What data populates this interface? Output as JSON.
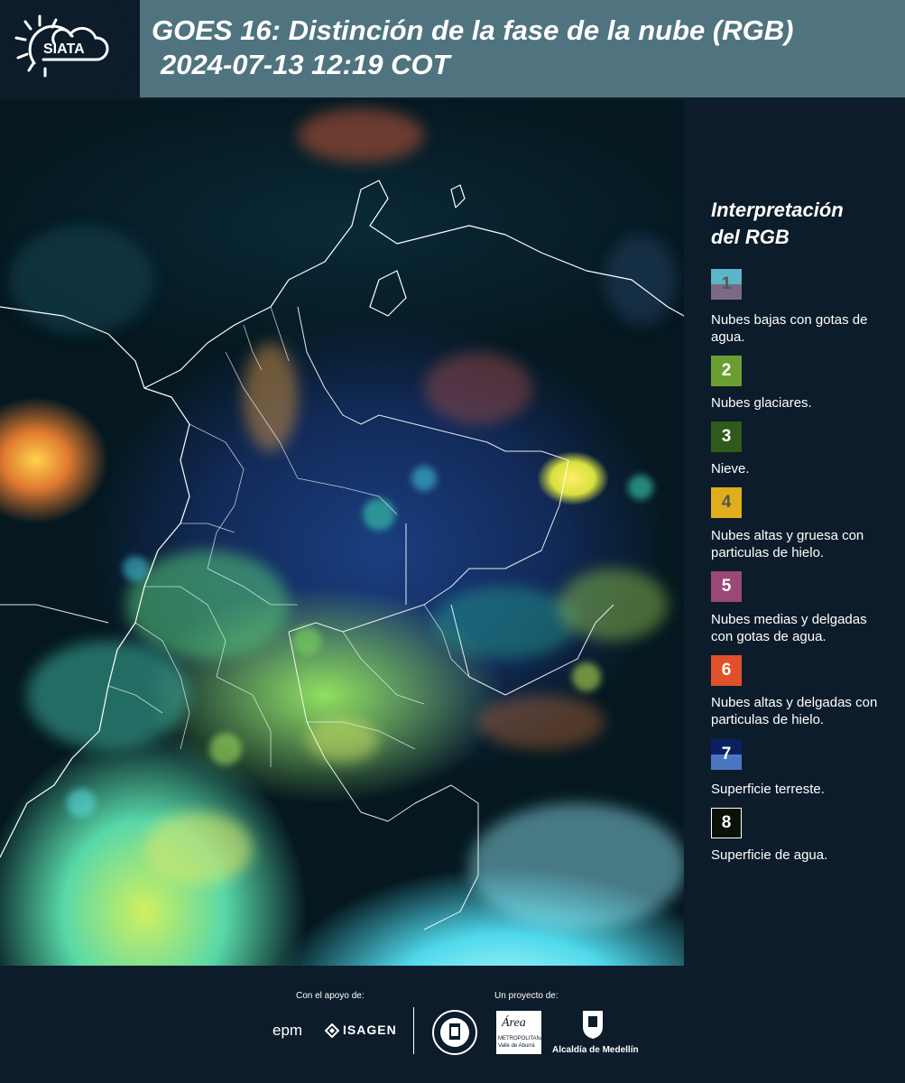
{
  "header": {
    "logo_text": "SIATA",
    "title_line1": "GOES 16: Distinción de la fase de la nube (RGB)",
    "title_line2": "2024-07-13 12:19 COT"
  },
  "legend": {
    "title_line1": "Interpretación",
    "title_line2": "del RGB",
    "items": [
      {
        "number": "1",
        "label": "Nubes bajas con gotas de agua.",
        "color_top": "#5ab6c8",
        "color_bottom": "#7a6a88",
        "text_color": "#555555"
      },
      {
        "number": "2",
        "label": "Nubes glaciares.",
        "color": "#6a9e30",
        "text_color": "#ffffff"
      },
      {
        "number": "3",
        "label": "Nieve.",
        "color": "#2f5a1c",
        "text_color": "#ffffff"
      },
      {
        "number": "4",
        "label": "Nubes altas y gruesa con particulas de hielo.",
        "color": "#e0ae1c",
        "text_color": "#555555"
      },
      {
        "number": "5",
        "label": "Nubes medias y delgadas con gotas de agua.",
        "color": "#9a4878",
        "text_color": "#ffffff"
      },
      {
        "number": "6",
        "label": "Nubes altas y delgadas con particulas de hielo.",
        "color": "#e0502c",
        "text_color": "#ffffff"
      },
      {
        "number": "7",
        "label": "Superficie terreste.",
        "color_top": "#0c2060",
        "color_bottom": "#4a78c0",
        "text_color": "#ffffff"
      },
      {
        "number": "8",
        "label": "Superficie de agua.",
        "color": "#0a1208",
        "border": "#ffffff",
        "text_color": "#ffffff"
      }
    ]
  },
  "footer": {
    "support_label": "Con el apoyo de:",
    "project_label": "Un proyecto de:",
    "sponsors": [
      "epm",
      "ISAGEN"
    ],
    "partners": [
      "Área Metropolitana Valle de Aburrá",
      "Alcaldía de Medellín"
    ],
    "area_name": "Área",
    "area_sub1": "METROPOLITANA",
    "area_sub2": "Valle de Aburrá",
    "alcaldia_label": "Alcaldía de Medellín"
  }
}
